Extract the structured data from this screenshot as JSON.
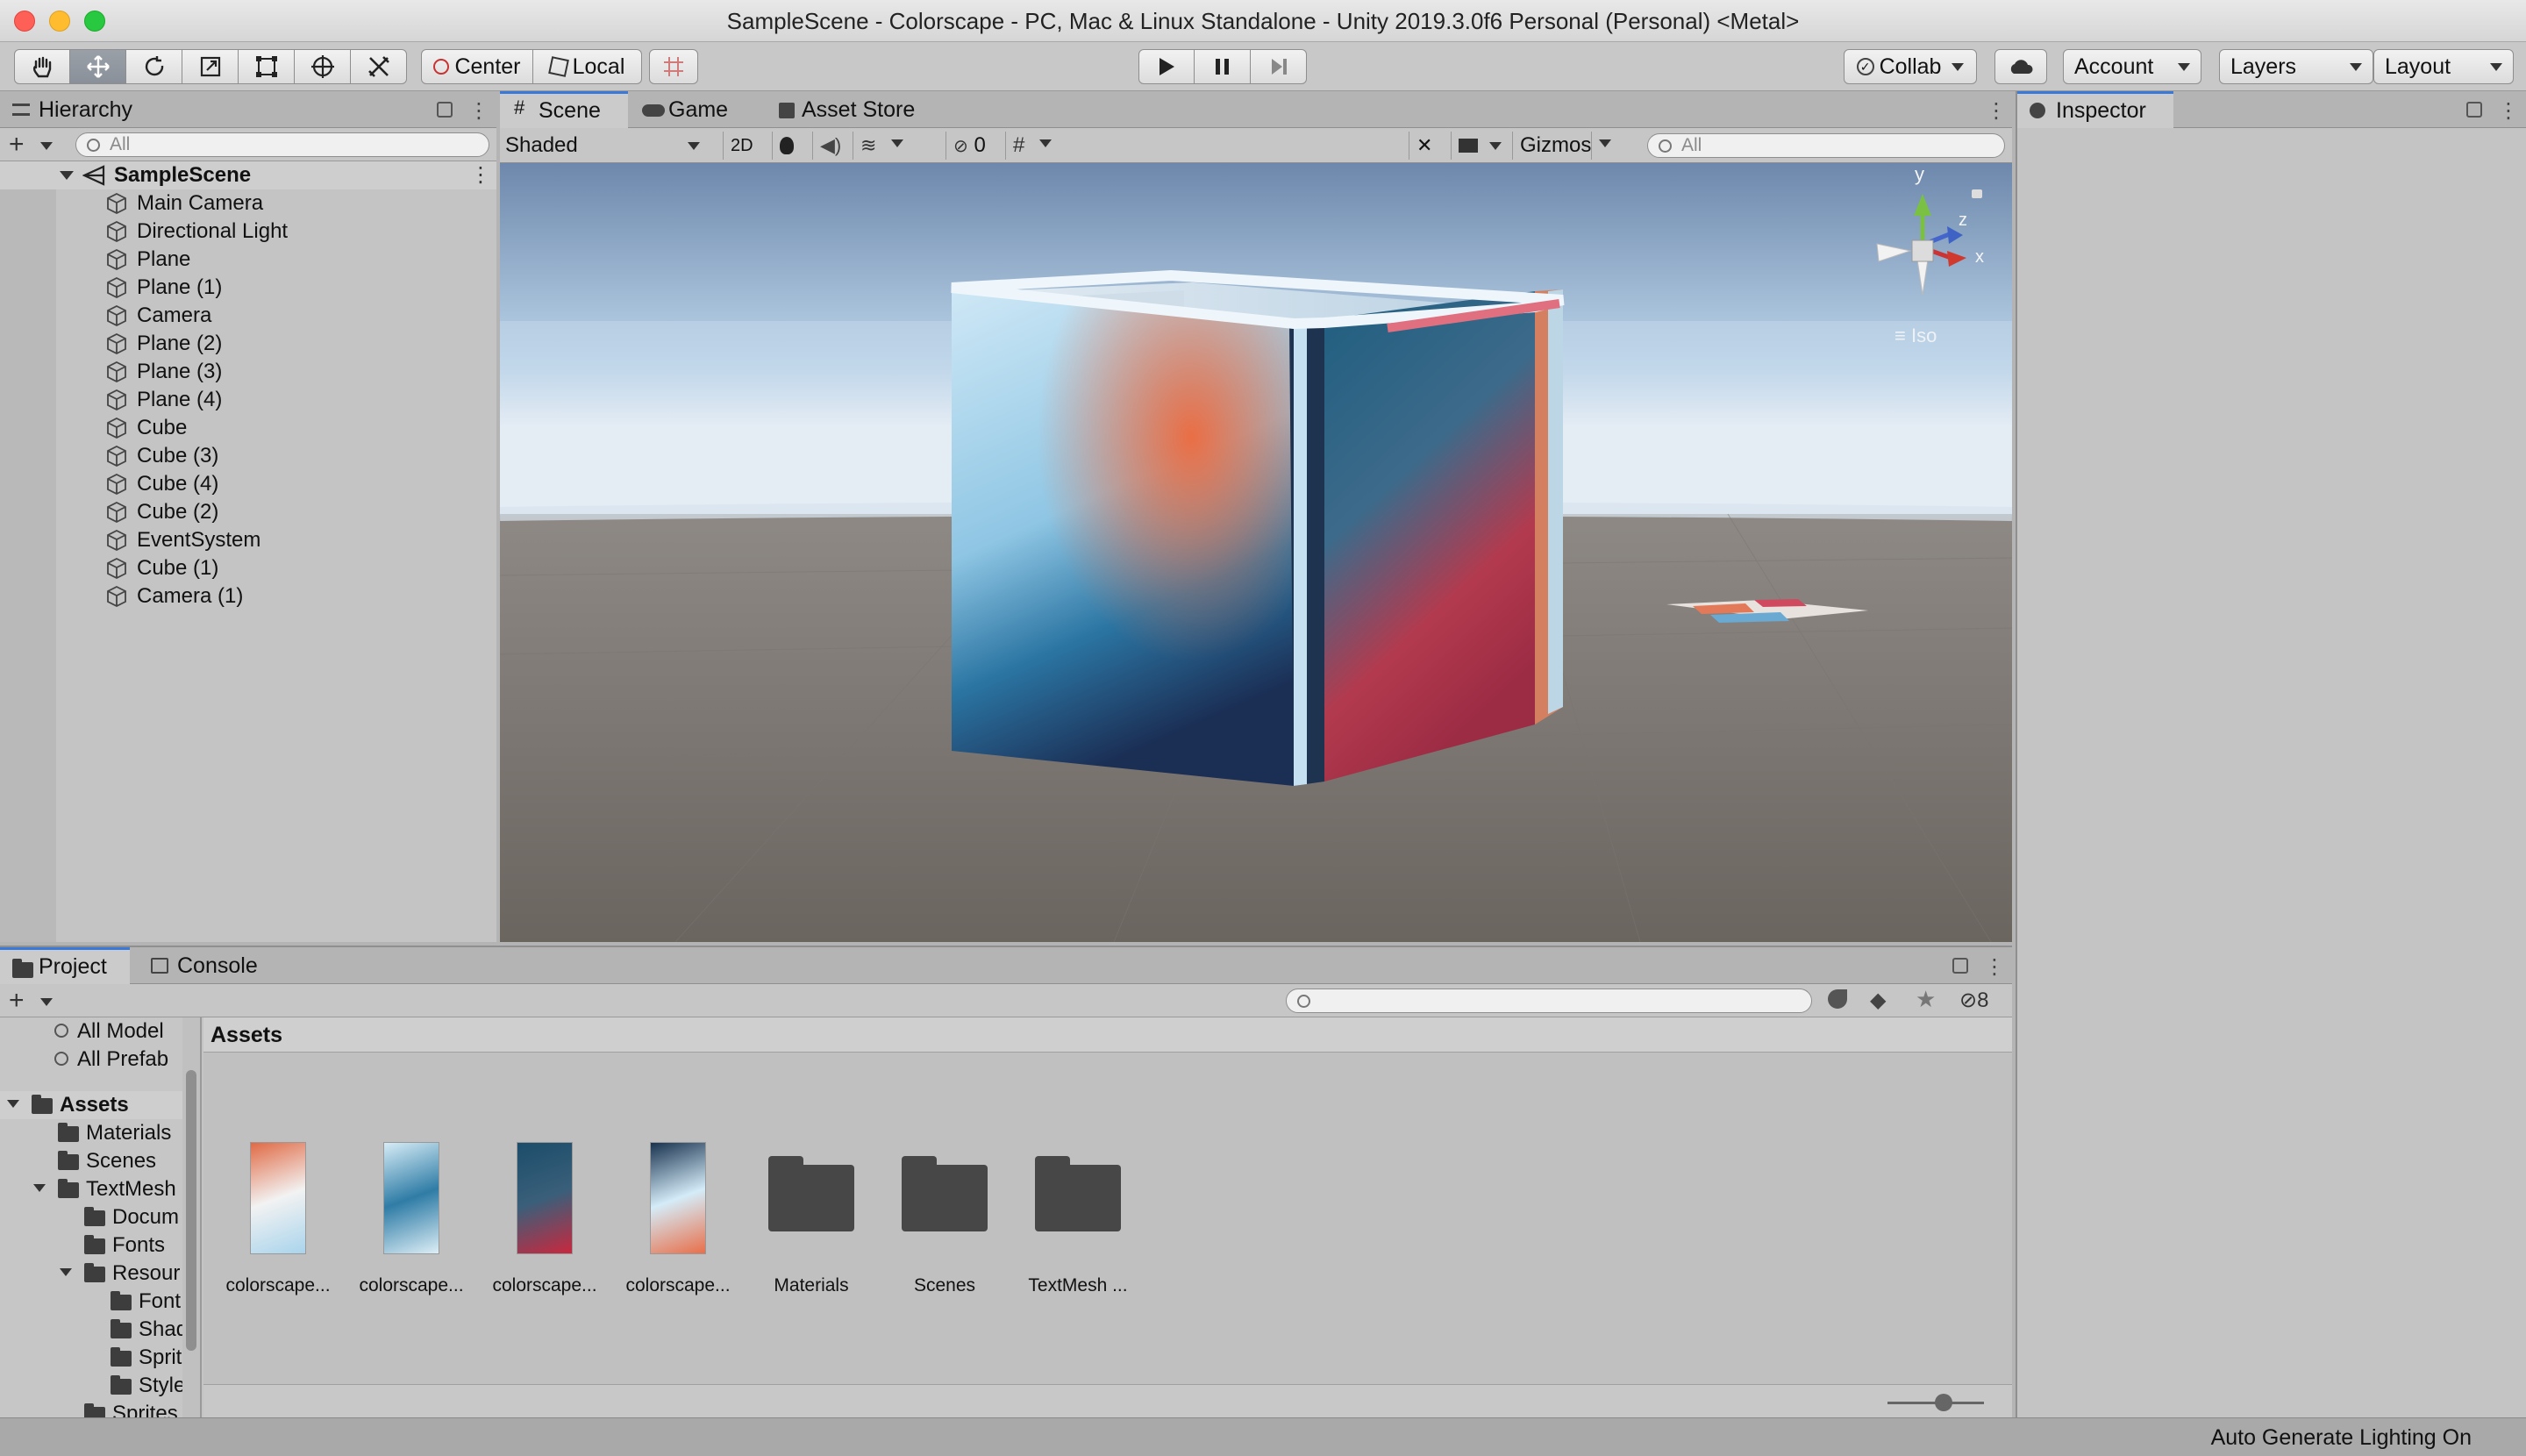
{
  "window": {
    "title": "SampleScene - Colorscape - PC, Mac & Linux Standalone - Unity 2019.3.0f6 Personal (Personal) <Metal>"
  },
  "toolbar": {
    "tools": [
      "hand-tool",
      "move-tool",
      "rotate-tool",
      "scale-tool",
      "rect-tool",
      "transform-tool",
      "custom-tool"
    ],
    "center_label": "Center",
    "local_label": "Local",
    "collab_label": "Collab",
    "account_label": "Account",
    "layers_label": "Layers",
    "layout_label": "Layout"
  },
  "hierarchy": {
    "tab_label": "Hierarchy",
    "search_placeholder": "All",
    "scene_name": "SampleScene",
    "items": [
      "Main Camera",
      "Directional Light",
      "Plane",
      "Plane (1)",
      "Camera",
      "Plane (2)",
      "Plane (3)",
      "Plane (4)",
      "Cube",
      "Cube (3)",
      "Cube (4)",
      "Cube (2)",
      "EventSystem",
      "Cube (1)",
      "Camera (1)"
    ]
  },
  "scene": {
    "tabs": [
      {
        "label": "Scene",
        "icon": "grid-icon"
      },
      {
        "label": "Game",
        "icon": "gamepad-icon"
      },
      {
        "label": "Asset Store",
        "icon": "shop-icon"
      }
    ],
    "shading_mode": "Shaded",
    "mode_2d_label": "2D",
    "hidden_count": "0",
    "gizmos_label": "Gizmos",
    "search_placeholder": "All",
    "gizmo_axes": {
      "y": "y",
      "z": "z",
      "x": "x"
    },
    "projection_label": "Iso"
  },
  "inspector": {
    "tab_label": "Inspector"
  },
  "project": {
    "tabs": [
      {
        "label": "Project",
        "icon": "folder-icon"
      },
      {
        "label": "Console",
        "icon": "console-icon"
      }
    ],
    "hidden_count": "8",
    "favorites": [
      "All Model",
      "All Prefab"
    ],
    "tree": [
      {
        "label": "Assets",
        "depth": 0,
        "expanded": true,
        "bold": true
      },
      {
        "label": "Materials",
        "depth": 1
      },
      {
        "label": "Scenes",
        "depth": 1
      },
      {
        "label": "TextMesh",
        "depth": 1,
        "expanded": true
      },
      {
        "label": "Docum",
        "depth": 2
      },
      {
        "label": "Fonts",
        "depth": 2
      },
      {
        "label": "Resour",
        "depth": 2,
        "expanded": true
      },
      {
        "label": "Font",
        "depth": 3
      },
      {
        "label": "Shad",
        "depth": 3
      },
      {
        "label": "Sprit",
        "depth": 3
      },
      {
        "label": "Style",
        "depth": 3
      },
      {
        "label": "Sprites",
        "depth": 2
      }
    ],
    "breadcrumb": "Assets",
    "assets": [
      {
        "label": "colorscape...",
        "kind": "texture",
        "colors": [
          "#e06a45",
          "#f2f2f2",
          "#a9d4ec"
        ]
      },
      {
        "label": "colorscape...",
        "kind": "texture",
        "colors": [
          "#d6ecf6",
          "#2f7ca6",
          "#ddeef6"
        ]
      },
      {
        "label": "colorscape...",
        "kind": "texture",
        "colors": [
          "#1b4d6a",
          "#3a5f7a",
          "#c8283e"
        ]
      },
      {
        "label": "colorscape...",
        "kind": "texture",
        "colors": [
          "#19324f",
          "#d4ecf8",
          "#e86f4a"
        ]
      },
      {
        "label": "Materials",
        "kind": "folder"
      },
      {
        "label": "Scenes",
        "kind": "folder"
      },
      {
        "label": "TextMesh ...",
        "kind": "folder"
      }
    ]
  },
  "status": {
    "text": "Auto Generate Lighting On"
  }
}
